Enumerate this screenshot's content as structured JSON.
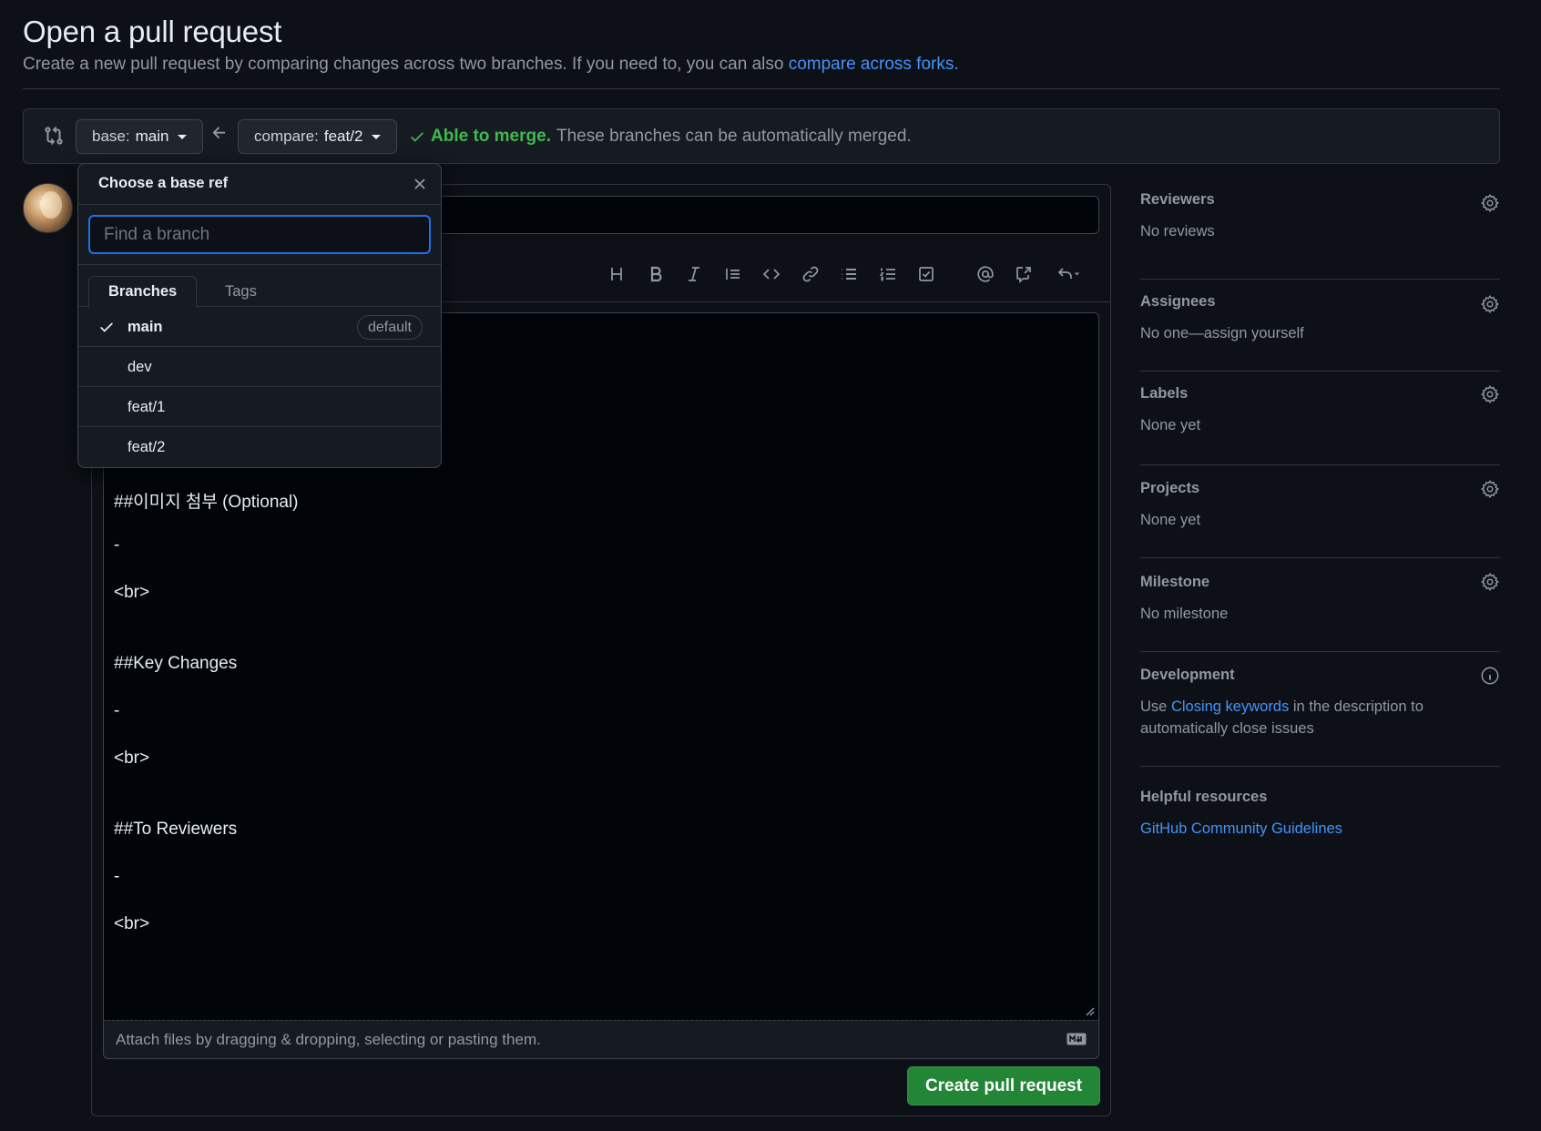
{
  "header": {
    "title": "Open a pull request",
    "subtitle_prefix": "Create a new pull request by comparing changes across two branches. If you need to, you can also ",
    "subtitle_link": "compare across forks.",
    "subtitle_suffix": ""
  },
  "range": {
    "base_prefix": "base: ",
    "base_branch": "main",
    "compare_prefix": "compare: ",
    "compare_branch": "feat/2",
    "merge_ok": "Able to merge.",
    "merge_text": "These branches can be automatically merged."
  },
  "dropdown": {
    "title": "Choose a base ref",
    "filter_placeholder": "Find a branch",
    "tabs": [
      "Branches",
      "Tags"
    ],
    "items": [
      {
        "name": "main",
        "selected": true,
        "badge": "default"
      },
      {
        "name": "dev",
        "selected": false,
        "badge": ""
      },
      {
        "name": "feat/1",
        "selected": false,
        "badge": ""
      },
      {
        "name": "feat/2",
        "selected": false,
        "badge": ""
      }
    ]
  },
  "toolbar": {
    "icons": [
      "heading-icon",
      "bold-icon",
      "italic-icon",
      "quote-icon",
      "code-icon",
      "link-icon",
      "unordered-list-icon",
      "ordered-list-icon",
      "task-list-icon",
      "mention-icon",
      "cross-reference-icon",
      "reply-icon"
    ]
  },
  "editor": {
    "lines": [
      "##이미지 첨부 (Optional)",
      "-",
      "<br>",
      "##Key Changes",
      "-",
      "<br>",
      "##To Reviewers",
      "-",
      "<br>"
    ],
    "attach_text": "Attach files by dragging & dropping, selecting or pasting them."
  },
  "submit_label": "Create pull request",
  "sidebar": {
    "reviewers": {
      "heading": "Reviewers",
      "value": "No reviews"
    },
    "assignees": {
      "heading": "Assignees",
      "value": "No one—assign yourself"
    },
    "labels": {
      "heading": "Labels",
      "value": "None yet"
    },
    "projects": {
      "heading": "Projects",
      "value": "None yet"
    },
    "milestone": {
      "heading": "Milestone",
      "value": "No milestone"
    },
    "development": {
      "heading": "Development",
      "value_prefix": "Use ",
      "value_link": "Closing keywords",
      "value_suffix": " in the description to automatically close issues"
    },
    "helpful": {
      "heading": "Helpful resources",
      "link": "GitHub Community Guidelines"
    }
  },
  "colors": {
    "background": "#0d1117",
    "accent_link": "#4493f8",
    "success": "#3fb950",
    "primary_button": "#238636"
  }
}
